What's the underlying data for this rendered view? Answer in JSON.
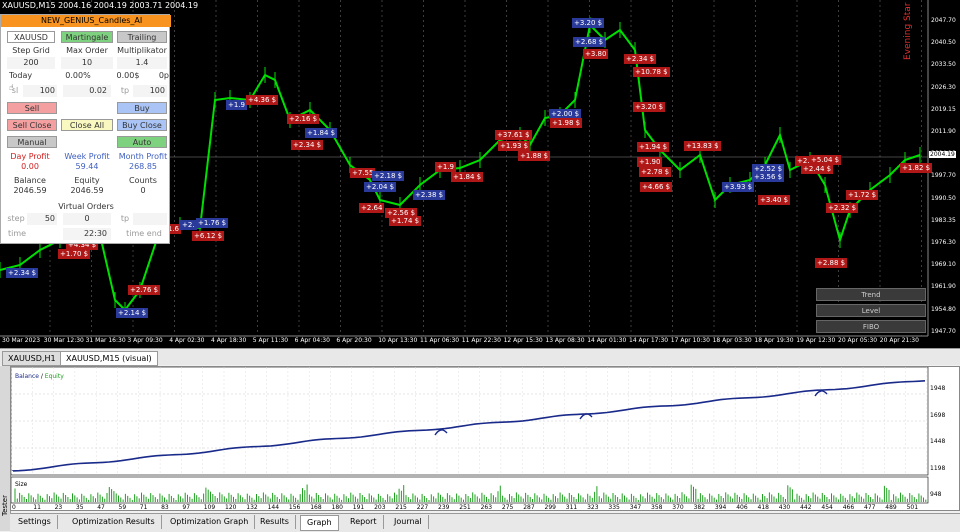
{
  "window": {
    "symbol_title": "XAUUSD,M15",
    "ohlc": "2004.16 2004.19 2003.71 2004.19"
  },
  "panel": {
    "title": "NEW_GENIUS_Candles_AI",
    "symbol": "XAUUSD",
    "martingale": "Martingale",
    "trailing": "Trailing",
    "step_grid_label": "Step Grid",
    "max_order_label": "Max Order",
    "multiplikator_label": "Multiplikator",
    "step_grid": "200",
    "max_order": "10",
    "multiplikator": "1.4",
    "today_label": "Today",
    "today_pct": "0.00%",
    "today_usd": "0.00$",
    "today_p": "0p",
    "sl_label": "sl",
    "sl": "100",
    "lot": "0.02",
    "tp_label": "tp",
    "tp": "100",
    "sell": "Sell",
    "buy": "Buy",
    "sell_close": "Sell Close",
    "close_all": "Close All",
    "buy_close": "Buy Close",
    "manual": "Manual",
    "auto": "Auto",
    "day_profit_label": "Day Profit",
    "week_profit_label": "Week Profit",
    "month_profit_label": "Month Profit",
    "day_profit": "0.00",
    "week_profit": "59.44",
    "month_profit": "268.85",
    "balance_label": "Balance",
    "equity_label": "Equity",
    "counts_label": "Counts",
    "balance": "2046.59",
    "equity": "2046.59",
    "counts": "0",
    "virtual_orders": "Virtual Orders",
    "step_label": "step",
    "step": "50",
    "vo_value": "0",
    "vo_tp_label": "tp",
    "vo_tp": "",
    "time_label": "time",
    "time_value": "22:30",
    "time_end": "time end"
  },
  "price_axis": [
    "2047.70",
    "2040.50",
    "2033.50",
    "2026.30",
    "2019.15",
    "2011.90",
    "2004.19",
    "1997.70",
    "1990.50",
    "1983.35",
    "1976.30",
    "1969.10",
    "1961.90",
    "1954.80",
    "1947.70"
  ],
  "current_price": "2004.19",
  "date_axis": [
    "30 Mar 2023",
    "30 Mar 12:30",
    "31 Mar 16:30",
    "3 Apr 09:30",
    "4 Apr 02:30",
    "4 Apr 18:30",
    "5 Apr 11:30",
    "6 Apr 04:30",
    "6 Apr 20:30",
    "10 Apr 13:30",
    "11 Apr 06:30",
    "11 Apr 22:30",
    "12 Apr 15:30",
    "13 Apr 08:30",
    "14 Apr 01:30",
    "14 Apr 17:30",
    "17 Apr 10:30",
    "18 Apr 03:30",
    "18 Apr 19:30",
    "19 Apr 12:30",
    "20 Apr 05:30",
    "20 Apr 21:30"
  ],
  "trade_labels": [
    {
      "text": "+2.34 $",
      "kind": "blue"
    },
    {
      "text": "+2.28",
      "kind": "blue"
    },
    {
      "text": "+4.34 $",
      "kind": "red"
    },
    {
      "text": "+1.70 $",
      "kind": "red"
    },
    {
      "text": "+2.76 $",
      "kind": "red"
    },
    {
      "text": "+2.14 $",
      "kind": "blue"
    },
    {
      "text": "+1.6",
      "kind": "red"
    },
    {
      "text": "+2.",
      "kind": "blue"
    },
    {
      "text": "+1.76 $",
      "kind": "blue"
    },
    {
      "text": "+6.12 $",
      "kind": "red"
    },
    {
      "text": "+1.9",
      "kind": "blue"
    },
    {
      "text": "+4.36 $",
      "kind": "red"
    },
    {
      "text": "+2.16 $",
      "kind": "red"
    },
    {
      "text": "+1.84 $",
      "kind": "blue"
    },
    {
      "text": "+2.34 $",
      "kind": "red"
    },
    {
      "text": "+7.55",
      "kind": "red"
    },
    {
      "text": "+2.18 $",
      "kind": "blue"
    },
    {
      "text": "+2.04 $",
      "kind": "blue"
    },
    {
      "text": "+2.64",
      "kind": "red"
    },
    {
      "text": "+2.56 $",
      "kind": "red"
    },
    {
      "text": "+1.74 $",
      "kind": "red"
    },
    {
      "text": "+2.38 $",
      "kind": "blue"
    },
    {
      "text": "+1.84 $",
      "kind": "red"
    },
    {
      "text": "+1.9",
      "kind": "red"
    },
    {
      "text": "+37.61 $",
      "kind": "red"
    },
    {
      "text": "+1.93 $",
      "kind": "red"
    },
    {
      "text": "+1.88 $",
      "kind": "red"
    },
    {
      "text": "+2.00 $",
      "kind": "blue"
    },
    {
      "text": "+1.98 $",
      "kind": "red"
    },
    {
      "text": "+3.20 $",
      "kind": "blue"
    },
    {
      "text": "+2.68 $",
      "kind": "blue"
    },
    {
      "text": "+3.80",
      "kind": "red"
    },
    {
      "text": "+2.34 $",
      "kind": "red"
    },
    {
      "text": "+10.78 $",
      "kind": "red"
    },
    {
      "text": "+3.20 $",
      "kind": "red"
    },
    {
      "text": "+1.94 $",
      "kind": "red"
    },
    {
      "text": "+1.90",
      "kind": "red"
    },
    {
      "text": "+2.78 $",
      "kind": "red"
    },
    {
      "text": "+4.66 $",
      "kind": "red"
    },
    {
      "text": "+13.83 $",
      "kind": "red"
    },
    {
      "text": "+3.93 $",
      "kind": "blue"
    },
    {
      "text": "+2.52 $",
      "kind": "blue"
    },
    {
      "text": "+3.56 $",
      "kind": "blue"
    },
    {
      "text": "+3.40 $",
      "kind": "red"
    },
    {
      "text": "+2.1",
      "kind": "red"
    },
    {
      "text": "+5.04 $",
      "kind": "red"
    },
    {
      "text": "+2.44 $",
      "kind": "red"
    },
    {
      "text": "+2.32 $",
      "kind": "red"
    },
    {
      "text": "+1.72 $",
      "kind": "red"
    },
    {
      "text": "+2.88 $",
      "kind": "red"
    },
    {
      "text": "+1.82 $",
      "kind": "red"
    }
  ],
  "side_text": "Evening Star - 15",
  "object_buttons": [
    "Trend",
    "Level",
    "FIBO"
  ],
  "chart_tabs": [
    "XAUUSD,H1",
    "XAUUSD,M15 (visual)"
  ],
  "tester": {
    "balance_label": "Balance",
    "equity_label": "Equity",
    "size_label": "Size",
    "side_label": "Tester",
    "y_ticks": [
      "1948",
      "1698",
      "1448",
      "1198",
      "948"
    ],
    "x_ticks": [
      "0",
      "11",
      "23",
      "35",
      "47",
      "59",
      "71",
      "83",
      "97",
      "109",
      "120",
      "132",
      "144",
      "156",
      "168",
      "180",
      "191",
      "203",
      "215",
      "227",
      "239",
      "251",
      "263",
      "275",
      "287",
      "299",
      "311",
      "323",
      "335",
      "347",
      "358",
      "370",
      "382",
      "394",
      "406",
      "418",
      "430",
      "442",
      "454",
      "466",
      "477",
      "489",
      "501"
    ],
    "tabs": [
      "Settings",
      "Optimization Results",
      "Optimization Graph",
      "Results",
      "Graph",
      "Report",
      "Journal"
    ],
    "active_tab": "Graph"
  },
  "colors": {
    "candles": "#00e000",
    "balance_line": "#1a2a8a",
    "sell_label": "#b01818",
    "buy_label": "#2a3a9a",
    "panel_title": "#f7931e"
  }
}
